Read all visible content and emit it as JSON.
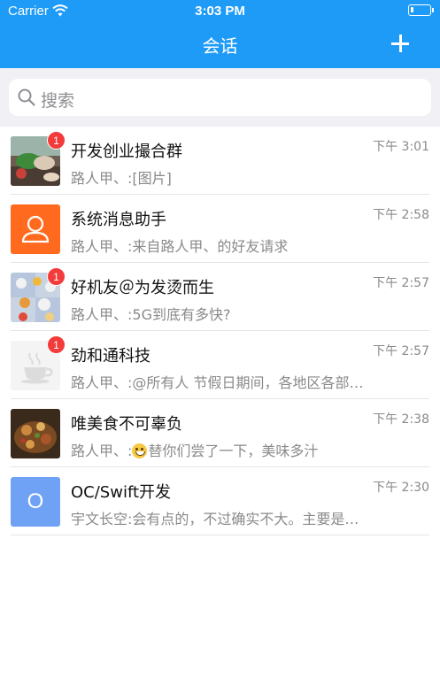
{
  "status_bar": {
    "carrier": "Carrier",
    "time": "3:03 PM",
    "battery_level": 0.15
  },
  "nav": {
    "title": "会话",
    "add_icon": "plus-icon"
  },
  "search": {
    "placeholder": "搜索",
    "icon": "search-icon"
  },
  "conversations": [
    {
      "name": "开发创业撮合群",
      "message": "路人甲、:[图片]",
      "time": "下午 3:01",
      "badge": "1",
      "avatar": "photo"
    },
    {
      "name": "系统消息助手",
      "message": "路人甲、:来自路人甲、的好友请求",
      "time": "下午 2:58",
      "badge": "",
      "avatar": "person-icon"
    },
    {
      "name": "好机友＠为发烫而生",
      "message": "路人甲、:5G到底有多快?",
      "time": "下午 2:57",
      "badge": "1",
      "avatar": "photo"
    },
    {
      "name": "劲和通科技",
      "message": "路人甲、:@所有人 节假日期间，各地区各部门要加强值班",
      "time": "下午 2:57",
      "badge": "1",
      "avatar": "coffee-cup-icon"
    },
    {
      "name": "唯美食不可辜负",
      "message_prefix": "路人甲、:",
      "message_suffix": "替你们尝了一下，美味多汁",
      "time": "下午 2:38",
      "badge": "",
      "avatar": "photo"
    },
    {
      "name": "OC/Swift开发",
      "message": "宇文长空:会有点的，不过确实不大。主要是速度",
      "time": "下午 2:30",
      "badge": "",
      "avatar_letter": "O"
    }
  ],
  "colors": {
    "header": "#1E9BF7",
    "badge": "#F33B3B",
    "system_avatar": "#FF6A1F",
    "letter_avatar": "#6FA2F5"
  }
}
